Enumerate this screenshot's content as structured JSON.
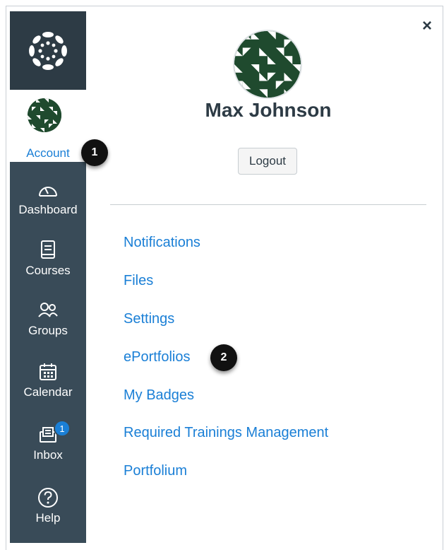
{
  "nav": {
    "account_label": "Account",
    "items": [
      {
        "label": "Dashboard",
        "icon": "dashboard-icon"
      },
      {
        "label": "Courses",
        "icon": "courses-icon"
      },
      {
        "label": "Groups",
        "icon": "groups-icon"
      },
      {
        "label": "Calendar",
        "icon": "calendar-icon"
      },
      {
        "label": "Inbox",
        "icon": "inbox-icon",
        "badge": "1"
      },
      {
        "label": "Help",
        "icon": "help-icon"
      }
    ]
  },
  "callouts": [
    "1",
    "2"
  ],
  "tray": {
    "user_name": "Max Johnson",
    "logout_label": "Logout",
    "close_symbol": "×",
    "links": [
      "Notifications",
      "Files",
      "Settings",
      "ePortfolios",
      "My Badges",
      "Required Trainings Management",
      "Portfolium"
    ]
  },
  "colors": {
    "nav_bg": "#394b58",
    "logo_bg": "#2d3b45",
    "link": "#1a7fd6",
    "avatar_green": "#1f4a2e"
  }
}
